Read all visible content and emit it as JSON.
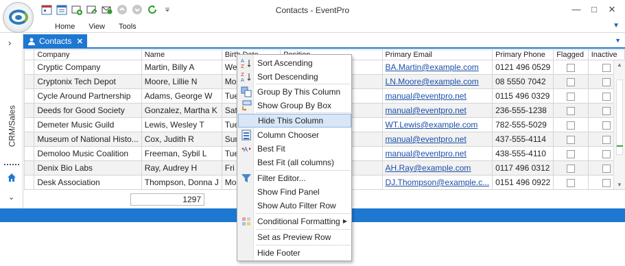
{
  "window": {
    "title": "Contacts - EventPro",
    "controls": [
      "—",
      "□",
      "✕"
    ]
  },
  "ribbon": {
    "tabs": [
      "Home",
      "View",
      "Tools"
    ]
  },
  "leftnav": {
    "section_label": "CRM/Sales"
  },
  "doc_tab": {
    "label": "Contacts"
  },
  "grid": {
    "columns": [
      "Company",
      "Name",
      "Birth Date",
      "Position",
      "Primary Email",
      "Primary Phone",
      "Flagged",
      "Inactive"
    ],
    "rows": [
      {
        "company": "Cryptic Company",
        "name": "Martin, Billy A",
        "birth": "Wed Oct",
        "position": "",
        "email": "BA.Martin@example.com",
        "phone": "0121 496 0529"
      },
      {
        "company": "Cryptonix Tech Depot",
        "name": "Moore, Lillie N",
        "birth": "Mon Nov",
        "position": "",
        "email": "LN.Moore@example.com",
        "phone": "08 5550 7042"
      },
      {
        "company": "Cycle Around Partnership",
        "name": "Adams, George W",
        "birth": "Tue Apr",
        "position": "oordinat...",
        "email": "manual@eventpro.net",
        "phone": "0115 496 0329"
      },
      {
        "company": "Deeds for Good Society",
        "name": "Gonzalez, Martha K",
        "birth": "Sat Sep 1",
        "position": "",
        "email": "manual@eventpro.net",
        "phone": "236-555-1238"
      },
      {
        "company": "Demeter Music Guild",
        "name": "Lewis, Wesley T",
        "birth": "Tue Dec",
        "position": "",
        "email": "WT.Lewis@example.com",
        "phone": "782-555-5029"
      },
      {
        "company": "Museum of National Histo...",
        "name": "Cox, Judith R",
        "birth": "Sun May",
        "position": "",
        "email": "manual@eventpro.net",
        "phone": "437-555-4114"
      },
      {
        "company": "Demoloo Music Coalition",
        "name": "Freeman, Sybil L",
        "birth": "Tue Dec",
        "position": "",
        "email": "manual@eventpro.net",
        "phone": "438-555-4110"
      },
      {
        "company": "Denix Bio Labs",
        "name": "Ray, Audrey H",
        "birth": "Fri May 1",
        "position": "or",
        "email": "AH.Ray@example.com",
        "phone": "0117 496 0312"
      },
      {
        "company": "Desk Association",
        "name": "Thompson, Donna J",
        "birth": "Mon Jan 3",
        "position": "ator",
        "email": "DJ.Thompson@example.c...",
        "phone": "0151 496 0922"
      }
    ],
    "footer_count": "1297"
  },
  "context_menu": {
    "items": [
      {
        "label": "Sort Ascending",
        "icon": "sort-ascending-icon"
      },
      {
        "label": "Sort Descending",
        "icon": "sort-descending-icon"
      },
      {
        "label": "Group By This Column",
        "icon": "group-by-column-icon"
      },
      {
        "label": "Show Group By Box",
        "icon": "group-by-box-icon"
      },
      {
        "label": "Hide This Column",
        "icon": ""
      },
      {
        "label": "Column Chooser",
        "icon": "column-chooser-icon"
      },
      {
        "label": "Best Fit",
        "icon": "best-fit-icon"
      },
      {
        "label": "Best Fit (all columns)",
        "icon": ""
      },
      {
        "label": "Filter Editor...",
        "icon": "filter-icon"
      },
      {
        "label": "Show Find Panel",
        "icon": ""
      },
      {
        "label": "Show Auto Filter Row",
        "icon": ""
      },
      {
        "label": "Conditional Formatting",
        "icon": "conditional-formatting-icon"
      },
      {
        "label": "Set as Preview Row",
        "icon": ""
      },
      {
        "label": "Hide Footer",
        "icon": ""
      }
    ],
    "highlighted": "Hide This Column"
  },
  "colors": {
    "accent": "#1e78d2",
    "link": "#1b4fa8",
    "highlight": "#d8e6f8"
  }
}
